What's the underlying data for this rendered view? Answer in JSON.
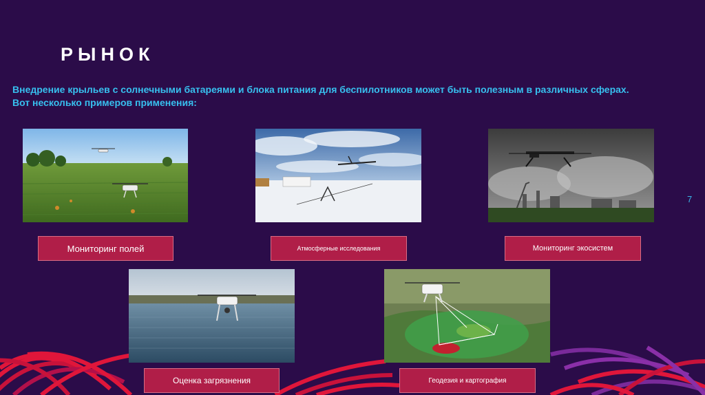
{
  "slide": {
    "title": "РЫНОК",
    "intro_line1": "Внедрение крыльев с солнечными батареями и блока питания для беспилотников может быть полезным в различных сферах.",
    "intro_line2": "Вот несколько примеров применения:",
    "page_number": "7"
  },
  "cards": [
    {
      "label": "Мониторинг полей"
    },
    {
      "label": "Атмосферные исследования"
    },
    {
      "label": "Мониторинг экосистем"
    },
    {
      "label": "Оценка загрязнения"
    },
    {
      "label": "Геодезия и картография"
    }
  ],
  "colors": {
    "background": "#2b0c49",
    "accent_text": "#37c0ef",
    "label_fill": "#b01e48",
    "ribbon_red": "#e0163a",
    "ribbon_purple": "#7a2a9a"
  }
}
